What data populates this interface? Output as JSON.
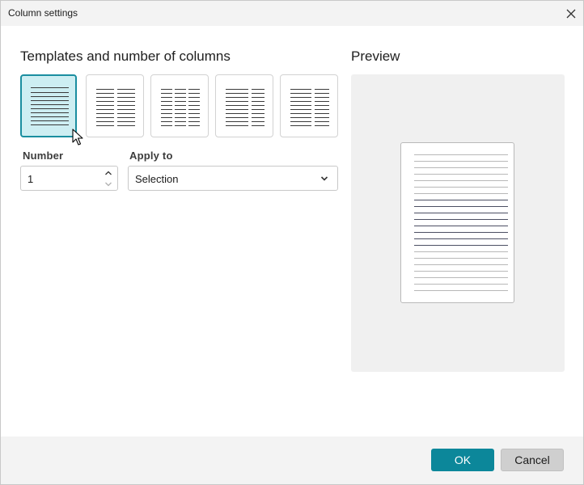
{
  "window": {
    "title": "Column settings",
    "close_icon": "close-icon"
  },
  "templates": {
    "heading": "Templates and number of columns",
    "options": [
      {
        "name": "one-column",
        "columns": 1,
        "selected": true
      },
      {
        "name": "two-columns",
        "columns": 2,
        "selected": false
      },
      {
        "name": "three-columns",
        "columns": 3,
        "selected": false
      },
      {
        "name": "two-columns-left-wide",
        "columns": 2,
        "selected": false
      },
      {
        "name": "two-columns-right-narrow",
        "columns": 2,
        "selected": false
      }
    ]
  },
  "number": {
    "label": "Number",
    "value": "1"
  },
  "apply_to": {
    "label": "Apply to",
    "value": "Selection"
  },
  "preview": {
    "heading": "Preview"
  },
  "footer": {
    "ok_label": "OK",
    "cancel_label": "Cancel"
  },
  "colors": {
    "accent": "#0c879a",
    "selected_bg": "#cdeef2"
  }
}
